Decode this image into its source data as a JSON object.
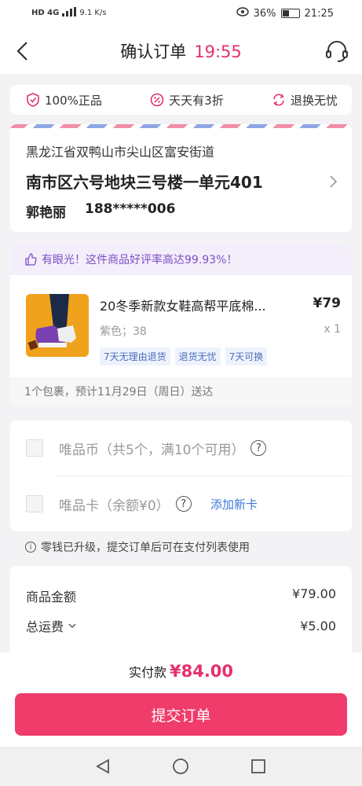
{
  "status_bar": {
    "network": "HD 4G",
    "speed": "9.1 K/s",
    "battery": "36%",
    "time": "21:25"
  },
  "header": {
    "title": "确认订单",
    "timer": "19:55"
  },
  "guarantees": [
    {
      "icon": "shield-icon",
      "label": "100%正品"
    },
    {
      "icon": "discount-icon",
      "label": "天天有3折"
    },
    {
      "icon": "exchange-icon",
      "label": "退换无忧"
    }
  ],
  "address": {
    "line1": "黑龙江省双鸭山市尖山区富安街道",
    "line2": "南市区六号地块三号楼一单元401",
    "name": "郭艳丽",
    "phone": "188*****006"
  },
  "goods": {
    "praise": "有眼光！这件商品好评率高达99.93%！",
    "name": "20冬季新款女鞋高帮平底棉...",
    "price": "¥79",
    "spec": "紫色；38",
    "qty": "x 1",
    "tags": [
      "7天无理由退货",
      "退货无忧",
      "7天可换"
    ],
    "delivery": "1个包裹，预计11月29日（周日）送达"
  },
  "vip": {
    "coin_label": "唯品币（共5个，满10个可用）",
    "card_label": "唯品卡（余额¥0）",
    "add_card": "添加新卡"
  },
  "notice": "零钱已升级，提交订单后可在支付列表使用",
  "summary": {
    "goods_amount_label": "商品金额",
    "goods_amount": "¥79.00",
    "shipping_label": "总运费",
    "shipping": "¥5.00"
  },
  "footer": {
    "pay_label": "实付款",
    "pay_amount": "¥84.00",
    "submit": "提交订单"
  },
  "colors": {
    "accent": "#e5306b",
    "button": "#ef3c6a",
    "link": "#3b78d8"
  }
}
